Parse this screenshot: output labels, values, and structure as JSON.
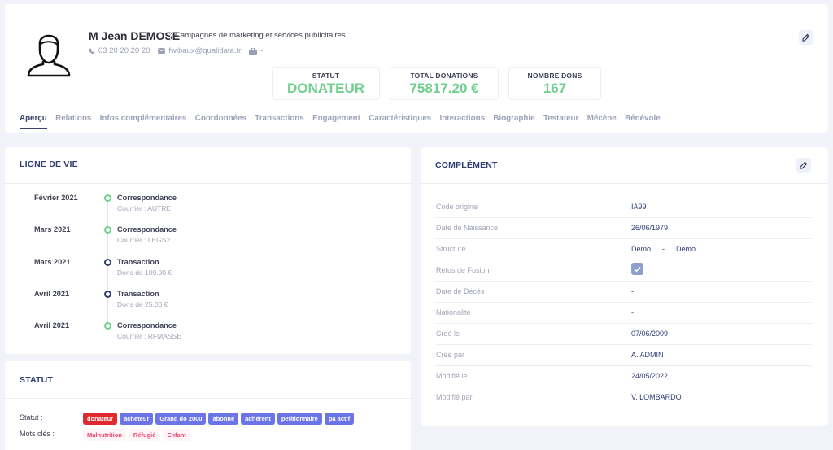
{
  "profile": {
    "name": "M Jean DEMOSE",
    "company": "Campagnes de marketing et services publicitaires",
    "phone": "03 20 20 20 20",
    "email": "fwibaux@qualidata.fr",
    "mail_value": "-"
  },
  "stats": {
    "statut": {
      "label": "STATUT",
      "value": "DONATEUR"
    },
    "total": {
      "label": "TOTAL DONATIONS",
      "value": "75817.20 €"
    },
    "nombre": {
      "label": "NOMBRE DONS",
      "value": "167"
    }
  },
  "tabs": [
    "Aperçu",
    "Relations",
    "Infos complémentaires",
    "Coordonnées",
    "Transactions",
    "Engagement",
    "Caractéristiques",
    "Interactions",
    "Biographie",
    "Testateur",
    "Mécène",
    "Bénévole"
  ],
  "active_tab": "Aperçu",
  "timeline": {
    "title": "LIGNE DE VIE",
    "items": [
      {
        "date": "Février 2021",
        "title": "Correspondance",
        "sub": "Courrier : AUTRE",
        "kind": "green"
      },
      {
        "date": "Mars 2021",
        "title": "Correspondance",
        "sub": "Courrier : LEGS2",
        "kind": "green"
      },
      {
        "date": "Mars 2021",
        "title": "Transaction",
        "sub": "Dons de 100.00 €",
        "kind": "blue"
      },
      {
        "date": "Avril 2021",
        "title": "Transaction",
        "sub": "Dons de 25.00 €",
        "kind": "blue"
      },
      {
        "date": "Avril 2021",
        "title": "Correspondance",
        "sub": "Courrier : RFMASSE",
        "kind": "green"
      }
    ]
  },
  "statut_card": {
    "title": "STATUT",
    "statut_label": "Statut :",
    "keywords_label": "Mots clés :",
    "badges": [
      "donateur",
      "acheteur",
      "Grand do 2000",
      "abonné",
      "adhérent",
      "petitionnaire",
      "pa actif"
    ],
    "keywords": [
      "Malnutrition",
      "Réfugié",
      "Enfant"
    ]
  },
  "complement": {
    "title": "COMPLÉMENT",
    "rows": {
      "code_origine": {
        "label": "Code origine",
        "value": "IA99"
      },
      "date_naissance": {
        "label": "Date de Naissance",
        "value": "26/06/1979"
      },
      "structure": {
        "label": "Structure",
        "value_a": "Demo",
        "sep": "-",
        "value_b": "Demo"
      },
      "refus_fusion": {
        "label": "Refus de Fusion",
        "checked": true
      },
      "date_deces": {
        "label": "Date de Décès",
        "value": "-"
      },
      "nationalite": {
        "label": "Nationalité",
        "value": "-"
      },
      "cree_le": {
        "label": "Créé le",
        "value": "07/06/2009"
      },
      "cree_par": {
        "label": "Crée par",
        "value": "A. ADMIN"
      },
      "modifie_le": {
        "label": "Modifié le",
        "value": "24/05/2022"
      },
      "modifie_par": {
        "label": "Modifié par",
        "value": "V. LOMBARDO"
      }
    }
  },
  "colors": {
    "accent_green": "#6fcf8d",
    "navy": "#2f3d73",
    "badge_red": "#e0282e",
    "badge_indigo": "#6b75e8",
    "keyword_pink": "#f1416c"
  },
  "icons": [
    "user-avatar-icon",
    "phone-icon",
    "mail-icon",
    "briefcase-icon",
    "edit-icon",
    "check-icon"
  ]
}
